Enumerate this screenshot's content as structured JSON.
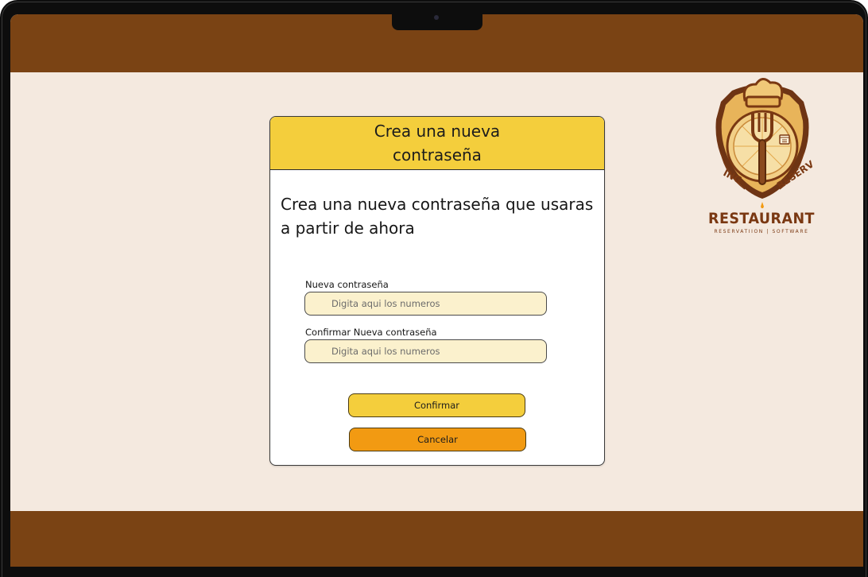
{
  "brand": {
    "name": "RESTAURANT",
    "tagline": "RESERVATIION | SOFTWARE"
  },
  "dialog": {
    "title": "Crea una nueva contraseña",
    "message": "Crea una nueva contraseña que usaras a partir de ahora",
    "new_password": {
      "label": "Nueva contraseña",
      "placeholder": "Digita aqui los numeros"
    },
    "confirm_password": {
      "label": "Confirmar Nueva contraseña",
      "placeholder": "Digita aqui los numeros"
    },
    "confirm_label": "Confirmar",
    "cancel_label": "Cancelar"
  },
  "colors": {
    "brown_band": "#7a4314",
    "background": "#f4e9df",
    "header_yellow": "#f4ce3c",
    "input_fill": "#fbf1cd",
    "cancel_orange": "#f29a12"
  },
  "icons": [
    "chef-hat-fork-logo-icon",
    "calendar-icon"
  ]
}
